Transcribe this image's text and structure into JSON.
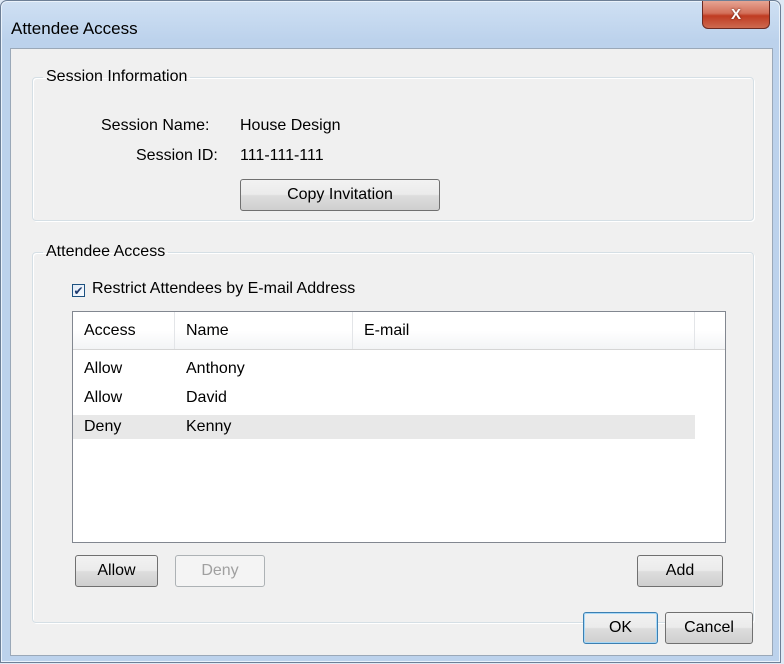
{
  "window": {
    "title": "Attendee Access",
    "close_glyph": "X"
  },
  "session_info": {
    "legend": "Session Information",
    "name_label": "Session Name:",
    "name_value": "House Design",
    "id_label": "Session ID:",
    "id_value": "111-111-111",
    "copy_button": "Copy Invitation"
  },
  "attendee_access": {
    "legend": "Attendee Access",
    "restrict_label": "Restrict Attendees by E-mail Address",
    "restrict_checked": true,
    "columns": [
      "Access",
      "Name",
      "E-mail"
    ],
    "rows": [
      {
        "access": "Allow",
        "name": "Anthony",
        "email": ""
      },
      {
        "access": "Allow",
        "name": "David",
        "email": ""
      },
      {
        "access": "Deny",
        "name": "Kenny",
        "email": "",
        "selected": true
      }
    ],
    "allow_button": "Allow",
    "deny_button": "Deny",
    "add_button": "Add"
  },
  "footer": {
    "ok_button": "OK",
    "cancel_button": "Cancel"
  }
}
